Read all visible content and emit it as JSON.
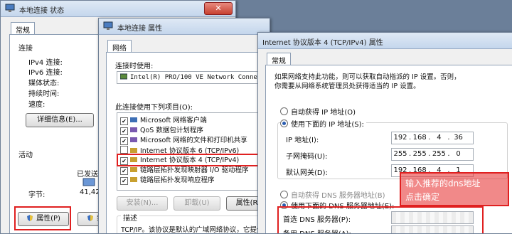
{
  "status_window": {
    "title": "本地连接 状态",
    "tab": "常规",
    "connection_header": "连接",
    "rows": [
      "IPv4 连接:",
      "IPv6 连接:",
      "媒体状态:",
      "持续时间:",
      "速度:"
    ],
    "details_button": "详细信息(E)...",
    "activity_header": "活动",
    "sent_label": "已发送",
    "bytes_label": "字节:",
    "bytes_value": "41,42",
    "properties_button": "属性(P)",
    "disable_button": "禁"
  },
  "props_window": {
    "title": "本地连接 属性",
    "tab": "网络",
    "connect_using_label": "连接时使用:",
    "adapter": "Intel(R) PRO/100 VE Network Conne",
    "items_label": "此连接使用下列项目(O):",
    "items": [
      {
        "label": "Microsoft 网络客户端",
        "checked": true
      },
      {
        "label": "QoS 数据包计划程序",
        "checked": true
      },
      {
        "label": "Microsoft 网络的文件和打印机共享",
        "checked": true
      },
      {
        "label": "Internet 协议版本 6 (TCP/IPv6)",
        "checked": false
      },
      {
        "label": "Internet 协议版本 4 (TCP/IPv4)",
        "checked": true
      },
      {
        "label": "链路层拓扑发现映射器 I/O 驱动程序",
        "checked": true
      },
      {
        "label": "链路层拓扑发现响应程序",
        "checked": true
      }
    ],
    "install_button": "安装(N)...",
    "uninstall_button": "卸载(U)",
    "properties_button": "属性(R)",
    "description_header": "描述",
    "description_text": "TCP/IP。该协议是默认的广域网络协议，它提供在不同"
  },
  "ipv4_window": {
    "title": "Internet 协议版本 4 (TCP/IPv4) 属性",
    "tab": "常规",
    "intro_line1": "如果网络支持此功能，则可以获取自动指派的 IP 设置。否则，",
    "intro_line2": "你需要从网络系统管理员处获得适当的 IP 设置。",
    "auto_ip": "自动获得 IP 地址(O)",
    "use_ip": "使用下面的 IP 地址(S):",
    "ip_label": "IP 地址(I):",
    "ip_value": [
      "192",
      "168",
      "4",
      "36"
    ],
    "mask_label": "子网掩码(U):",
    "mask_value": [
      "255",
      "255",
      "255",
      "0"
    ],
    "gateway_label": "默认网关(D):",
    "gateway_value": [
      "192",
      "168",
      "4",
      "1"
    ],
    "auto_dns": "自动获得 DNS 服务器地址(B)",
    "use_dns": "使用下面的 DNS 服务器地址(E):",
    "preferred_dns_label": "首选 DNS 服务器(P):",
    "alternate_dns_label": "备用 DNS 服务器(A):"
  },
  "annotation": {
    "line1": "输入推荐的dns地址",
    "line2": "点击确定"
  },
  "colors": {
    "annotation_red": "#e02020",
    "title_gradient_top": "#dfe9f5",
    "title_gradient_bottom": "#c4d6ec"
  }
}
